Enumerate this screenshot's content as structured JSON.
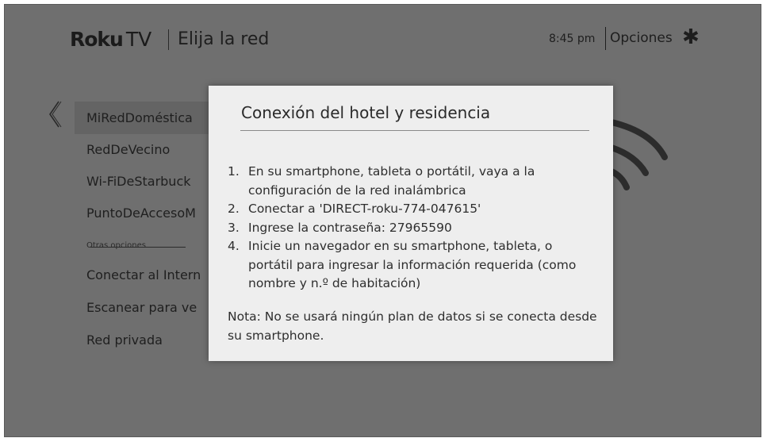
{
  "header": {
    "brand": "Roku",
    "brand_suffix": "TV",
    "title": "Elija la red",
    "time": "8:45 pm",
    "options_label": "Opciones",
    "options_icon": "asterisk-icon"
  },
  "networks": [
    {
      "label": "MiRedDoméstica",
      "selected": true
    },
    {
      "label": "RedDeVecino"
    },
    {
      "label": "Wi-FiDeStarbuck"
    },
    {
      "label": "PuntoDeAccesoM"
    }
  ],
  "other_options": {
    "label": "Otras opciones",
    "items": [
      {
        "label": "Conectar al Intern"
      },
      {
        "label": "Escanear para ve"
      },
      {
        "label": "Red privada"
      }
    ]
  },
  "dialog": {
    "title": "Conexión del hotel y residencia",
    "steps": [
      {
        "num": "1.",
        "text": "En su smartphone, tableta o portátil, vaya a la configuración de la red inalámbrica"
      },
      {
        "num": "2.",
        "text": "Conectar a 'DIRECT-roku-774-047615'"
      },
      {
        "num": "3.",
        "text": "Ingrese la contraseña: 27965590"
      },
      {
        "num": "4.",
        "text": "Inicie un navegador en su smartphone, tableta, o portátil para ingresar la información requerida (como nombre y n.º de habitación)"
      }
    ],
    "note": "Nota: No se usará ningún plan de datos si se conecta desde su smartphone."
  },
  "colors": {
    "screen_dim": "#6f6f6f",
    "dialog_bg": "#eeeeee",
    "selected_bg": "#646464"
  }
}
